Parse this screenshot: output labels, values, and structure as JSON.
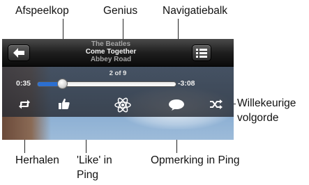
{
  "callouts": {
    "afspeelkop": "Afspeelkop",
    "genius": "Genius",
    "navigatiebalk": "Navigatiebalk",
    "willekeurige_line1": "Willekeurige",
    "willekeurige_line2": "volgorde",
    "herhalen": "Herhalen",
    "like_line1": "'Like' in",
    "like_line2": "Ping",
    "opmerking": "Opmerking in Ping"
  },
  "now_playing": {
    "artist": "The Beatles",
    "song": "Come Together",
    "album": "Abbey Road",
    "track_position": "2 of 9",
    "elapsed": "0:35",
    "remaining": "-3:08",
    "progress_fraction": 0.18
  },
  "icons": {
    "back": "back-arrow-icon",
    "list": "track-list-icon",
    "repeat": "repeat-icon",
    "like": "thumbs-up-icon",
    "genius": "genius-atom-icon",
    "comment": "speech-bubble-icon",
    "shuffle": "shuffle-icon"
  },
  "colors": {
    "scrub_fill": "#2c6fd0",
    "topbar": "#1d1d1d"
  }
}
